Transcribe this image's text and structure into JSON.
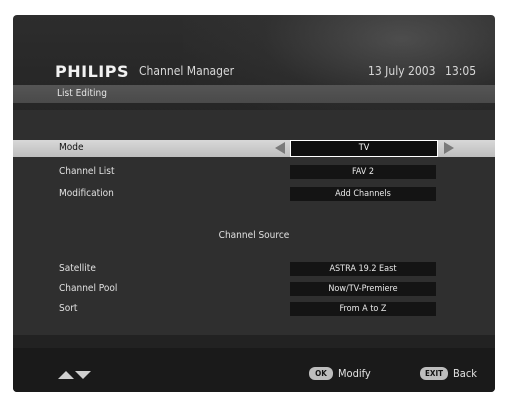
{
  "header": {
    "brand": "PHILIPS",
    "app_title": "Channel Manager",
    "date": "13 July 2003",
    "time": "13:05"
  },
  "subheader": {
    "label": "List Editing"
  },
  "settings": [
    {
      "label": "Mode",
      "value": "TV",
      "selected": true
    },
    {
      "label": "Channel List",
      "value": "FAV 2",
      "selected": false
    },
    {
      "label": "Modification",
      "value": "Add Channels",
      "selected": false
    }
  ],
  "section": {
    "title": "Channel Source"
  },
  "source_settings": [
    {
      "label": "Satellite",
      "value": "ASTRA 19.2 East"
    },
    {
      "label": "Channel Pool",
      "value": "Now/TV-Premiere"
    },
    {
      "label": "Sort",
      "value": "From A to Z"
    }
  ],
  "footer": {
    "ok_key": "OK",
    "ok_label": "Modify",
    "exit_key": "EXIT",
    "exit_label": "Back"
  },
  "colors": {
    "background": "#1f1f1f",
    "panel": "#2f2f2f",
    "selected_row": "#cfcfcf",
    "value_box": "#141414"
  }
}
